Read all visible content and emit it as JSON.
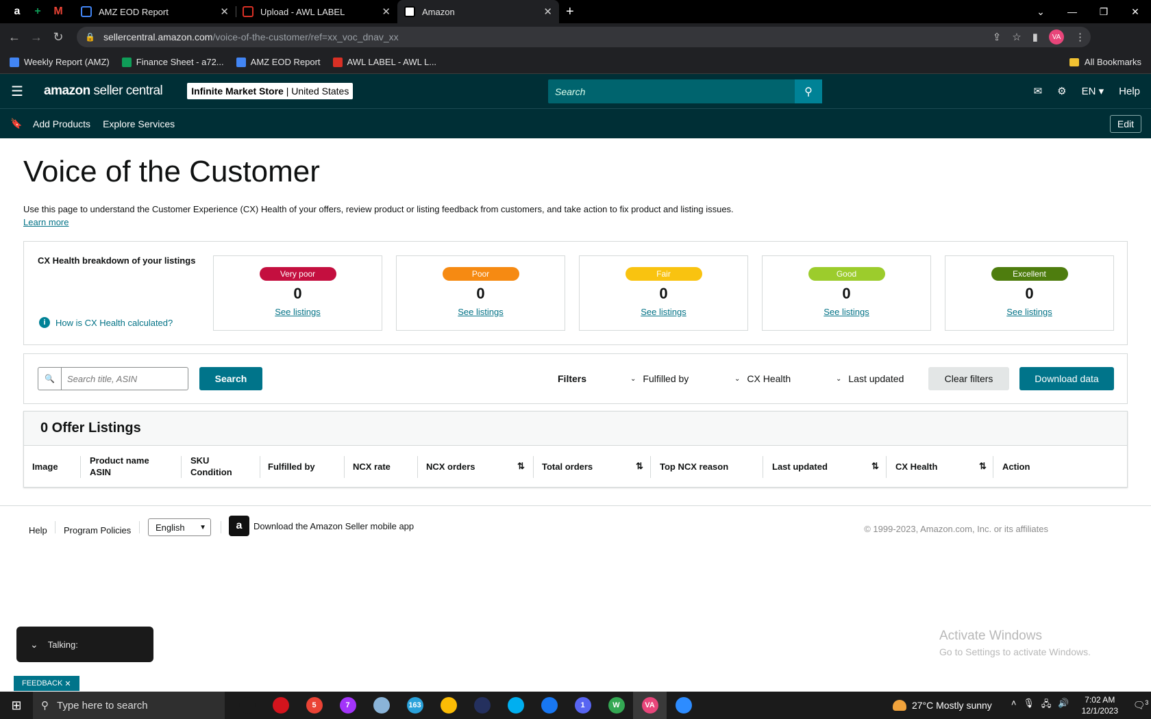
{
  "browser": {
    "pinned_tabs": [
      {
        "icon": "amazon-icon",
        "glyph": "a",
        "color": "#000000"
      },
      {
        "icon": "sheets-icon",
        "glyph": "+",
        "color": "#0f9d58"
      },
      {
        "icon": "gmail-icon",
        "glyph": "M",
        "color": "#ea4335"
      }
    ],
    "tabs": [
      {
        "title": "AMZ EOD Report",
        "icon": "report-icon",
        "color": "#4285f4",
        "active": false
      },
      {
        "title": "Upload - AWL LABEL",
        "icon": "awl-icon",
        "color": "#d93025",
        "active": false
      },
      {
        "title": "Amazon",
        "icon": "amazon-icon",
        "color": "#000000",
        "active": true
      }
    ],
    "url_host": "sellercentral.amazon.com",
    "url_path": "/voice-of-the-customer/ref=xx_voc_dnav_xx",
    "profile_initials": "VA",
    "bookmarks": [
      {
        "label": "Weekly Report (AMZ)",
        "color": "#4285f4"
      },
      {
        "label": "Finance Sheet - a72...",
        "color": "#0f9d58"
      },
      {
        "label": "AMZ EOD Report",
        "color": "#4285f4"
      },
      {
        "label": "AWL LABEL - AWL L...",
        "color": "#d93025"
      }
    ],
    "all_bookmarks": "All Bookmarks"
  },
  "header": {
    "logo_main": "amazon",
    "logo_sub": "seller central",
    "store_name": "Infinite Market Store",
    "store_region": "United States",
    "search_placeholder": "Search",
    "language": "EN",
    "help": "Help"
  },
  "subnav": {
    "items": [
      "Add Products",
      "Explore Services"
    ],
    "edit": "Edit"
  },
  "page": {
    "title": "Voice of the Customer",
    "description": "Use this page to understand the Customer Experience (CX) Health of your offers, review product or listing feedback from customers, and take action to fix product and listing issues.",
    "learn_more": "Learn more"
  },
  "cx_health": {
    "title": "CX Health breakdown of your listings",
    "how_link": "How is CX Health calculated?",
    "cards": [
      {
        "label": "Very poor",
        "count": "0",
        "link": "See listings",
        "color": "#c40f3f"
      },
      {
        "label": "Poor",
        "count": "0",
        "link": "See listings",
        "color": "#f68a12"
      },
      {
        "label": "Fair",
        "count": "0",
        "link": "See listings",
        "color": "#f9c310"
      },
      {
        "label": "Good",
        "count": "0",
        "link": "See listings",
        "color": "#9ccc2c"
      },
      {
        "label": "Excellent",
        "count": "0",
        "link": "See listings",
        "color": "#4e7d0e"
      }
    ]
  },
  "filters": {
    "search_placeholder": "Search title, ASIN",
    "search_button": "Search",
    "filters_label": "Filters",
    "dropdowns": [
      "Fulfilled by",
      "CX Health",
      "Last updated"
    ],
    "clear": "Clear filters",
    "download": "Download data"
  },
  "offers": {
    "heading": "0 Offer Listings",
    "columns": [
      {
        "line1": "Image",
        "line2": ""
      },
      {
        "line1": "Product name",
        "line2": "ASIN"
      },
      {
        "line1": "SKU",
        "line2": "Condition"
      },
      {
        "line1": "Fulfilled by",
        "line2": ""
      },
      {
        "line1": "NCX rate",
        "line2": ""
      },
      {
        "line1": "NCX orders",
        "line2": ""
      },
      {
        "line1": "Total orders",
        "line2": ""
      },
      {
        "line1": "Top NCX reason",
        "line2": ""
      },
      {
        "line1": "Last updated",
        "line2": ""
      },
      {
        "line1": "CX Health",
        "line2": ""
      },
      {
        "line1": "Action",
        "line2": ""
      }
    ]
  },
  "footer": {
    "help": "Help",
    "policies": "Program Policies",
    "language": "English",
    "app_text": "Download the Amazon Seller mobile app",
    "copyright": "© 1999-2023, Amazon.com, Inc. or its affiliates"
  },
  "overlays": {
    "talking": "Talking:",
    "feedback": "FEEDBACK",
    "watermark_title": "Activate Windows",
    "watermark_sub": "Go to Settings to activate Windows."
  },
  "taskbar": {
    "search_placeholder": "Type here to search",
    "apps": [
      {
        "icon": "task-view-icon",
        "color": "#1b1b1b",
        "badge": ""
      },
      {
        "icon": "opera-icon",
        "color": "#d4141d",
        "badge": ""
      },
      {
        "icon": "chrome-icon",
        "color": "#ea4335",
        "badge": "5"
      },
      {
        "icon": "messenger-icon",
        "color": "#a334fa",
        "badge": "7"
      },
      {
        "icon": "app-icon",
        "color": "#8ab4d8",
        "badge": ""
      },
      {
        "icon": "telegram-icon",
        "color": "#2aa1da",
        "badge": "163"
      },
      {
        "icon": "chrome-icon",
        "color": "#fbbc05",
        "badge": ""
      },
      {
        "icon": "clock-app-icon",
        "color": "#24305e",
        "badge": ""
      },
      {
        "icon": "skype-icon",
        "color": "#00aff0",
        "badge": ""
      },
      {
        "icon": "facebook-icon",
        "color": "#1877f2",
        "badge": ""
      },
      {
        "icon": "discord-icon",
        "color": "#5865f2",
        "badge": "1"
      },
      {
        "icon": "chrome-icon",
        "color": "#34a853",
        "badge": "W"
      },
      {
        "icon": "chrome-icon",
        "color": "#e8457a",
        "badge": "VA"
      },
      {
        "icon": "zoom-icon",
        "color": "#2d8cff",
        "badge": ""
      }
    ],
    "weather": "27°C  Mostly sunny",
    "time": "7:02 AM",
    "date": "12/1/2023",
    "notifications": "3"
  }
}
